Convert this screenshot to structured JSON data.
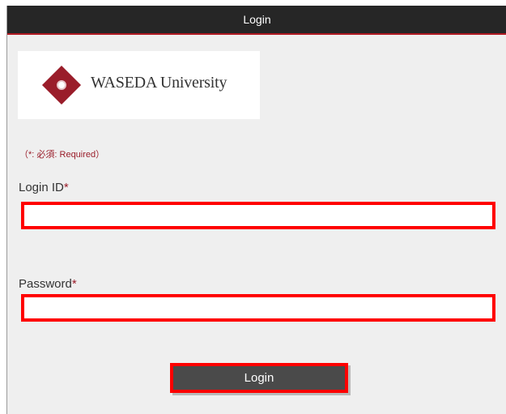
{
  "header": {
    "title": "Login"
  },
  "logo": {
    "text": "WASEDA University",
    "icon": "waseda-seal-icon",
    "brand_color": "#9a1d2a"
  },
  "form": {
    "required_note": "（*: 必須: Required）",
    "login_id": {
      "label": "Login ID",
      "required_mark": "*",
      "value": "",
      "placeholder": ""
    },
    "password": {
      "label": "Password",
      "required_mark": "*",
      "value": "",
      "placeholder": ""
    },
    "submit_label": "Login"
  },
  "colors": {
    "header_bg": "#262626",
    "header_accent": "#b01a23",
    "panel_bg": "#efefef",
    "highlight": "#ff0000",
    "button_bg": "#4a4a4a"
  }
}
